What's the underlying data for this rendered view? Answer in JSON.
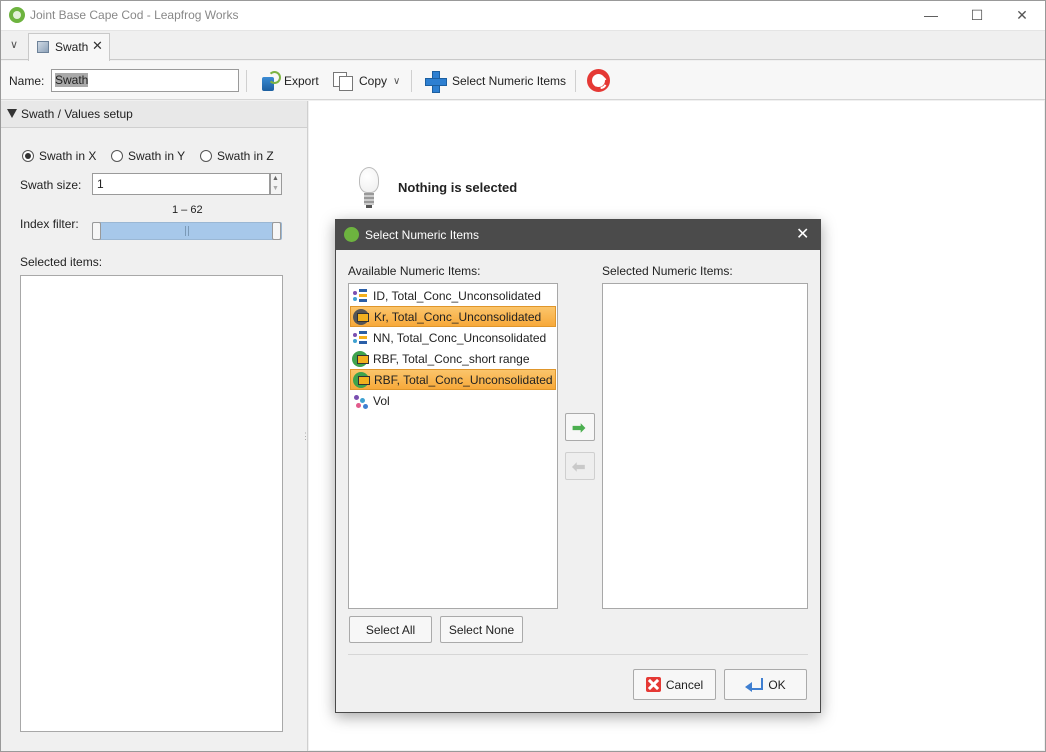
{
  "window": {
    "title": "Joint Base Cape Cod - Leapfrog Works",
    "minimize_glyph": "—",
    "maximize_glyph": "☐",
    "close_glyph": "✕"
  },
  "tabs": [
    {
      "label": "Swath",
      "close": "✕"
    }
  ],
  "tab_menu_glyph": "∨",
  "toolbar": {
    "name_label": "Name:",
    "name_value": "Swath",
    "export_label": "Export",
    "copy_label": "Copy",
    "copy_chevron": "∨",
    "select_numeric_label": "Select Numeric Items"
  },
  "left_panel": {
    "section_title": "Swath / Values setup",
    "radios": [
      {
        "label": "Swath in X",
        "checked": true
      },
      {
        "label": "Swath in Y",
        "checked": false
      },
      {
        "label": "Swath in Z",
        "checked": false
      }
    ],
    "swath_size_label": "Swath size:",
    "swath_size_value": "1",
    "index_filter_label": "Index filter:",
    "index_range": "1 – 62",
    "selected_items_label": "Selected items:"
  },
  "right_panel": {
    "message": "Nothing is selected"
  },
  "dialog": {
    "title": "Select Numeric Items",
    "close_glyph": "✕",
    "available_label": "Available Numeric Items:",
    "selected_label": "Selected Numeric Items:",
    "available_items": [
      {
        "label": "ID, Total_Conc_Unconsolidated",
        "icon": "id-interpolant-icon",
        "selected": false
      },
      {
        "label": "Kr, Total_Conc_Unconsolidated",
        "icon": "kriging-icon",
        "selected": true
      },
      {
        "label": "NN, Total_Conc_Unconsolidated",
        "icon": "nearest-neighbour-icon",
        "selected": false
      },
      {
        "label": "RBF, Total_Conc_short range",
        "icon": "rbf-icon",
        "selected": false
      },
      {
        "label": "RBF, Total_Conc_Unconsolidated",
        "icon": "rbf-icon",
        "selected": true
      },
      {
        "label": "Vol",
        "icon": "points-icon",
        "selected": false
      }
    ],
    "selected_items": [],
    "add_glyph": "➡",
    "remove_glyph": "⬅",
    "select_all_label": "Select All",
    "select_none_label": "Select None",
    "cancel_label": "Cancel",
    "ok_label": "OK"
  },
  "colors": {
    "dialog_titlebar": "#4b4b4b",
    "selection": "#f7a93a",
    "accent_blue": "#2d7fd1",
    "add_arrow": "#4caf50"
  }
}
